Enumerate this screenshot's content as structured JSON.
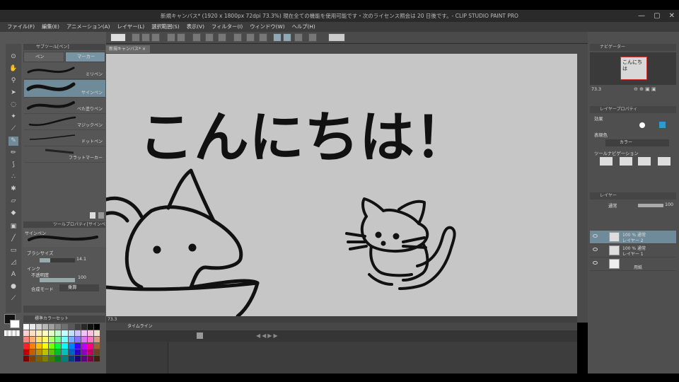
{
  "window": {
    "title": "新規キャンバス* (1920 x 1800px 72dpi 73.3%)  現在全ての機能を使用可能です・次のライセンス照会は 20 日後です。- CLIP STUDIO PAINT PRO",
    "min_label": "—",
    "max_label": "▢",
    "close_label": "✕"
  },
  "menu": [
    "ファイル(F)",
    "編集(E)",
    "アニメーション(A)",
    "レイヤー(L)",
    "選択範囲(S)",
    "表示(V)",
    "フィルター(I)",
    "ウィンドウ(W)",
    "ヘルプ(H)"
  ],
  "subtool": {
    "header": "サブツール[ペン]",
    "tabs": [
      "ペン",
      "マーカー"
    ],
    "brushes": [
      {
        "label": "ミリペン",
        "selected": false
      },
      {
        "label": "サインペン",
        "selected": true
      },
      {
        "label": "べた塗りペン",
        "selected": false
      },
      {
        "label": "マジックペン",
        "selected": false
      },
      {
        "label": "ドットペン",
        "selected": false
      },
      {
        "label": "フラットマーカー",
        "selected": false
      }
    ]
  },
  "tool_property": {
    "header": "ツールプロパティ[サインペン]",
    "tool_name": "サインペン",
    "brush_size_label": "ブラシサイズ",
    "brush_size_value": "14.1",
    "ink_label": "インク",
    "opacity_label": "不透明度",
    "opacity_value": "100",
    "blend_label": "合成モード",
    "blend_value": "乗算"
  },
  "color_set": {
    "header": "標準カラーセット",
    "colors": [
      "#ffffff",
      "#e8e8e8",
      "#d0d0d0",
      "#b8b8b8",
      "#a0a0a0",
      "#888888",
      "#707070",
      "#585858",
      "#404040",
      "#282828",
      "#101010",
      "#000000",
      "#ffd0d0",
      "#ffe0c0",
      "#fff0c0",
      "#ffffc0",
      "#e0ffc0",
      "#c0ffd0",
      "#c0ffff",
      "#c0e0ff",
      "#d0c0ff",
      "#f0c0ff",
      "#ffc0e0",
      "#f0e0d0",
      "#ff8080",
      "#ffb070",
      "#ffe070",
      "#ffff60",
      "#b0ff70",
      "#70ff90",
      "#70ffff",
      "#70b0ff",
      "#9070ff",
      "#e070ff",
      "#ff70c0",
      "#d0a080",
      "#ff2020",
      "#ff8000",
      "#ffc000",
      "#ffff00",
      "#80ff00",
      "#00ff40",
      "#00ffff",
      "#0080ff",
      "#4000ff",
      "#c000ff",
      "#ff0080",
      "#a06030",
      "#c00000",
      "#c06000",
      "#c09000",
      "#c0c000",
      "#60c000",
      "#00c030",
      "#00c0c0",
      "#0060c0",
      "#3000c0",
      "#9000c0",
      "#c00060",
      "#704020",
      "#800000",
      "#804000",
      "#806000",
      "#808000",
      "#408000",
      "#008020",
      "#008080",
      "#004080",
      "#200080",
      "#600080",
      "#800040",
      "#402010"
    ]
  },
  "document": {
    "tab_label": "新規キャンバス*",
    "heading_text": "こんにちは！",
    "zoom": "73.3"
  },
  "timeline": {
    "header": "タイムライン"
  },
  "navigator": {
    "header": "ナビゲーター",
    "zoom": "73.3",
    "preview_text": "こんにちは"
  },
  "layer_property": {
    "header": "レイヤープロパティ",
    "effect_label": "効果",
    "expression_color_label": "表現色",
    "color_value": "カラー",
    "tool_nav_label": "ツールナビゲーション"
  },
  "layers": {
    "header": "レイヤー",
    "blend_mode": "通常",
    "opacity": "100",
    "items": [
      {
        "line1": "100 % 通常",
        "line2": "レイヤー 2",
        "selected": true
      },
      {
        "line1": "100 % 通常",
        "line2": "レイヤー 1",
        "selected": false
      },
      {
        "line1": "",
        "line2": "用紙",
        "selected": false
      }
    ]
  }
}
